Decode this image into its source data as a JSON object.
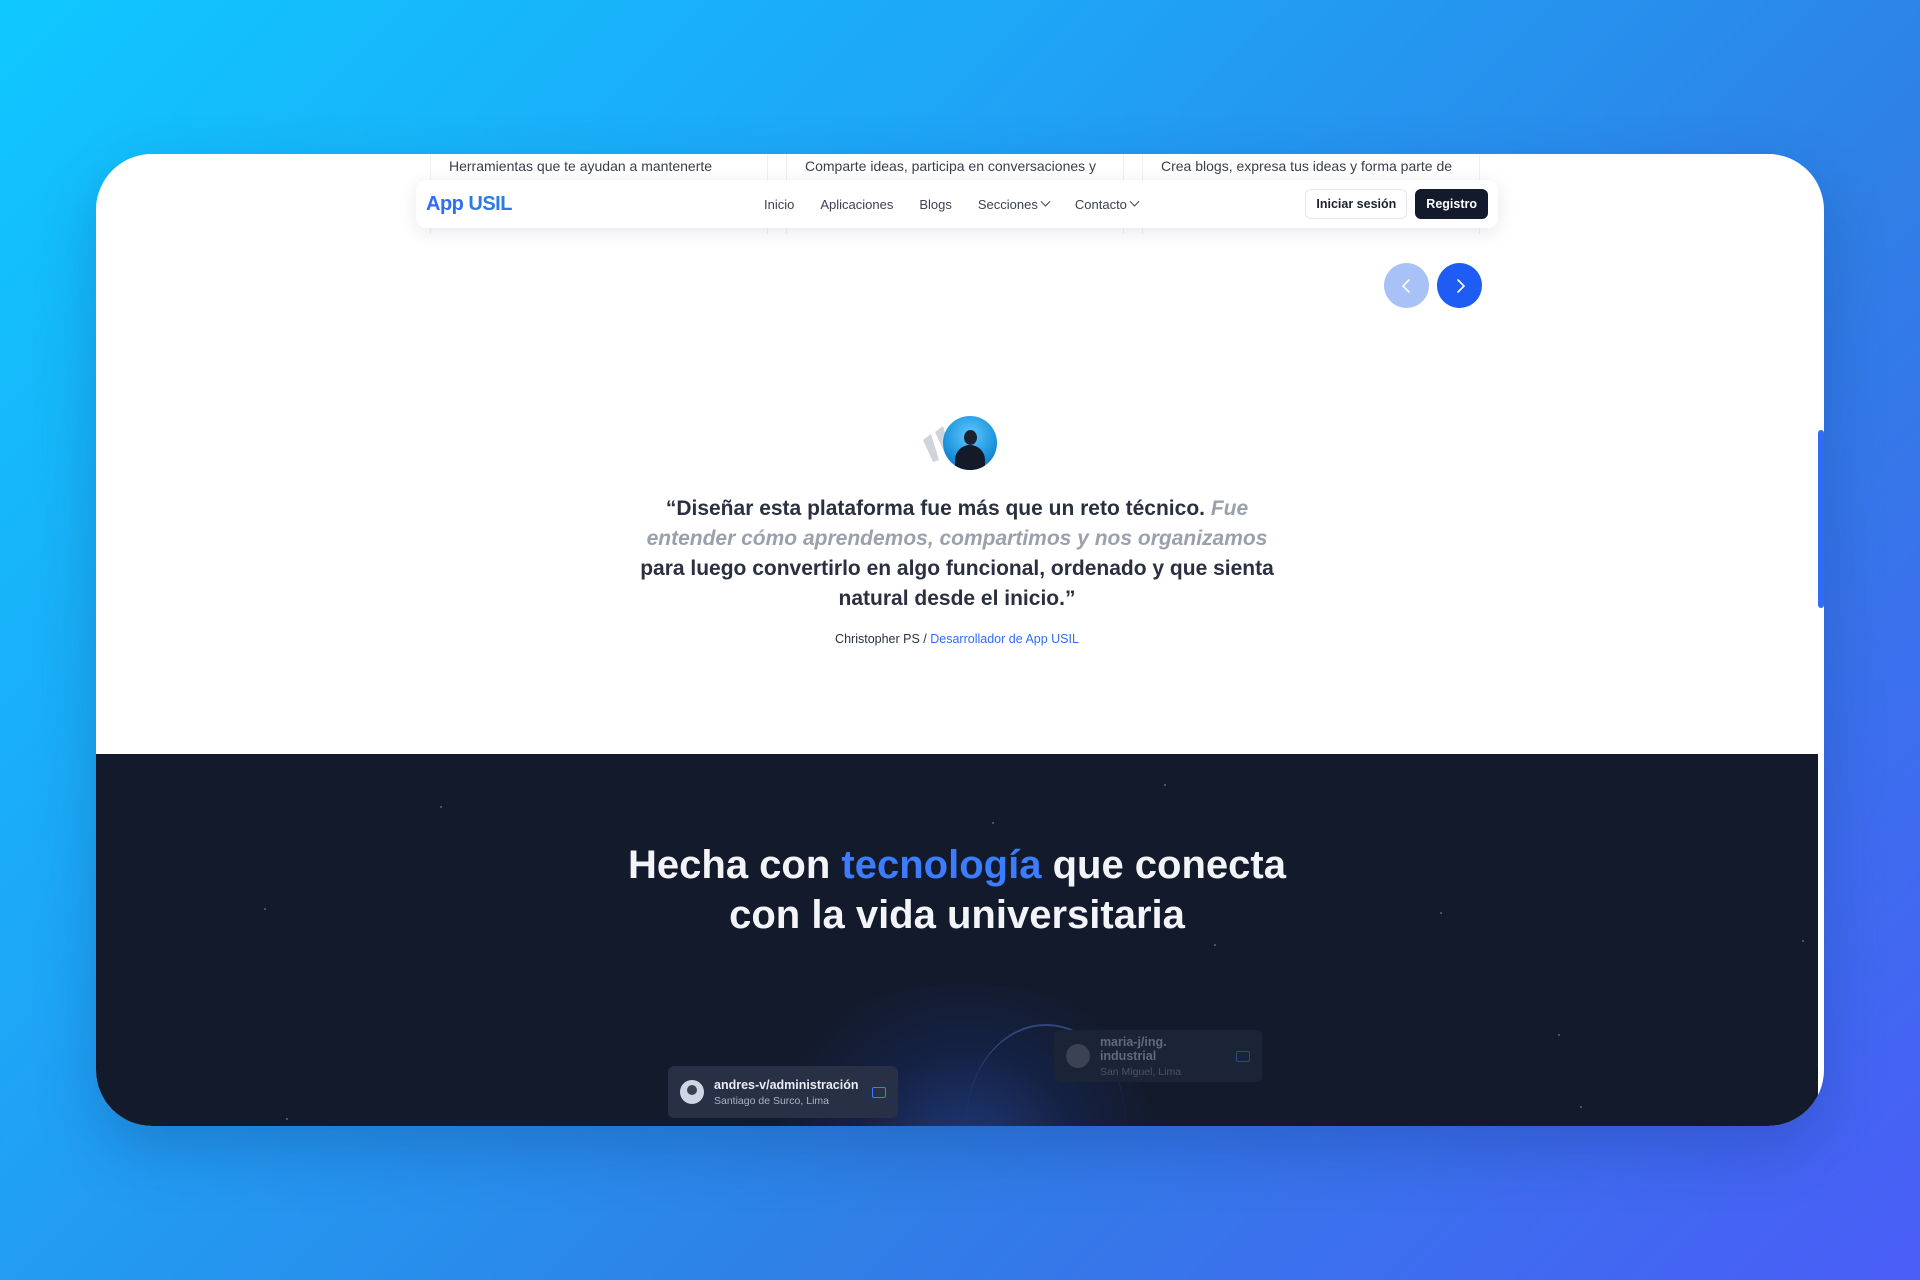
{
  "feature_cards": [
    {
      "text": "Herramientas que te ayudan a mantenerte"
    },
    {
      "text": "Comparte ideas, participa en conversaciones y"
    },
    {
      "text": "Crea blogs, expresa tus ideas y forma parte de"
    }
  ],
  "navbar": {
    "logo_app": "App",
    "logo_usil": "USIL",
    "links": [
      "Inicio",
      "Aplicaciones",
      "Blogs",
      "Secciones",
      "Contacto"
    ],
    "login_label": "Iniciar sesión",
    "register_label": "Registro"
  },
  "testimonial": {
    "quote_part1": "“Diseñar esta plataforma fue más que un reto técnico.",
    "quote_part2": "Fue entender cómo aprendemos, compartimos y nos organizamos",
    "quote_part3": "para luego convertirlo en algo funcional, ordenado y que sienta natural desde el inicio.”",
    "author_name": "Christopher PS /",
    "author_role": "Desarrollador de App USIL"
  },
  "tech_section": {
    "headline_part1": "Hecha con",
    "headline_accent": "tecnología",
    "headline_part2": "que conecta",
    "headline_line2": "con la vida universitaria",
    "users": [
      {
        "name": "andres-v/administración",
        "location": "Santiago de Surco, Lima"
      },
      {
        "name": "maria-j/ing. industrial",
        "location": "San Miguel, Lima"
      }
    ]
  },
  "colors": {
    "accent": "#2f6df6",
    "dark_bg": "#131a2b",
    "register_bg": "#131a2b"
  }
}
